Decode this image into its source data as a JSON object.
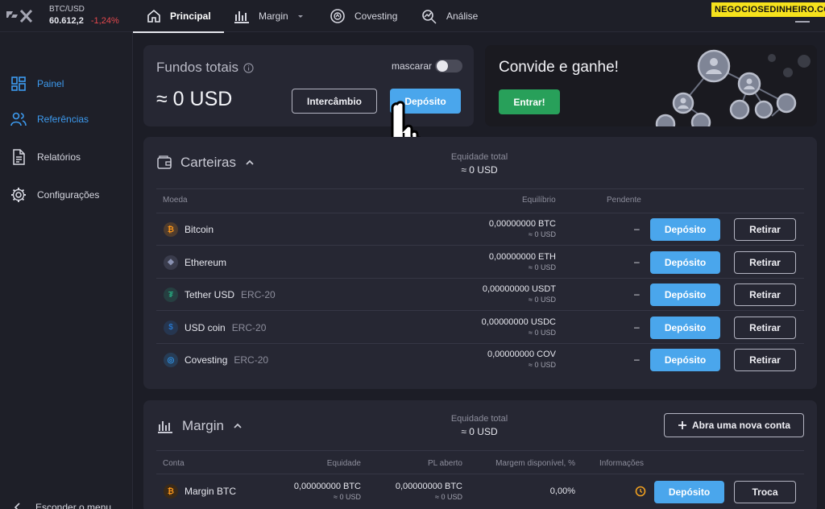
{
  "topbar": {
    "ticker_pair": "BTC/USD",
    "ticker_price": "60.612,2",
    "ticker_change": "-1,24%",
    "tabs": [
      {
        "label": "Principal",
        "icon": "home-icon"
      },
      {
        "label": "Margin",
        "icon": "bar-chart-icon"
      },
      {
        "label": "Covesting",
        "icon": "covesting-icon"
      },
      {
        "label": "Análise",
        "icon": "analysis-icon"
      }
    ],
    "watermark": "NEGOCIOSEDINHEIRO.COM"
  },
  "sidebar": {
    "items": [
      {
        "label": "Painel",
        "icon": "dashboard-icon"
      },
      {
        "label": "Referências",
        "icon": "referrals-icon"
      },
      {
        "label": "Relatórios",
        "icon": "report-icon"
      },
      {
        "label": "Configurações",
        "icon": "settings-icon"
      }
    ],
    "collapse_label": "Esconder o menu"
  },
  "funds": {
    "title": "Fundos totais",
    "value": "≈ 0 USD",
    "mask_label": "mascarar",
    "exchange_button": "Intercâmbio",
    "deposit_button": "Depósito"
  },
  "invite": {
    "title": "Convide e ganhe!",
    "button": "Entrar!"
  },
  "wallets": {
    "title": "Carteiras",
    "equity_label": "Equidade total",
    "equity_value": "≈ 0 USD",
    "headers": {
      "currency": "Moeda",
      "balance": "Equilíbrio",
      "pending": "Pendente"
    },
    "deposit_label": "Depósito",
    "withdraw_label": "Retirar",
    "rows": [
      {
        "name": "Bitcoin",
        "network": "",
        "balance": "0,00000000 BTC",
        "usd": "≈ 0 USD",
        "pending": "–",
        "icon": "bitcoin-icon",
        "color": "#f7931a"
      },
      {
        "name": "Ethereum",
        "network": "",
        "balance": "0,00000000 ETH",
        "usd": "≈ 0 USD",
        "pending": "–",
        "icon": "ethereum-icon",
        "color": "#8a92b2"
      },
      {
        "name": "Tether USD",
        "network": "ERC-20",
        "balance": "0,00000000 USDT",
        "usd": "≈ 0 USD",
        "pending": "–",
        "icon": "tether-icon",
        "color": "#26a17b"
      },
      {
        "name": "USD coin",
        "network": "ERC-20",
        "balance": "0,00000000 USDC",
        "usd": "≈ 0 USD",
        "pending": "–",
        "icon": "usdc-icon",
        "color": "#2775ca"
      },
      {
        "name": "Covesting",
        "network": "ERC-20",
        "balance": "0,00000000 COV",
        "usd": "≈ 0 USD",
        "pending": "–",
        "icon": "covesting-coin-icon",
        "color": "#2f8fe0"
      }
    ]
  },
  "margin": {
    "title": "Margin",
    "equity_label": "Equidade total",
    "equity_value": "≈ 0 USD",
    "new_account_button": "Abra uma nova conta",
    "headers": {
      "account": "Conta",
      "equity": "Equidade",
      "pl": "PL aberto",
      "available": "Margem disponível, %",
      "info": "Informações"
    },
    "rows": [
      {
        "name": "Margin BTC",
        "equity": "0,00000000 BTC",
        "equity_usd": "≈ 0 USD",
        "pl": "0,00000000 BTC",
        "pl_usd": "≈ 0 USD",
        "available": "0,00%",
        "deposit": "Depósito",
        "trade": "Troca"
      }
    ]
  },
  "colors": {
    "accent": "#4aa6ec",
    "green": "#28a05a",
    "negative": "#e5484d",
    "active_nav": "#3d9bf0"
  }
}
